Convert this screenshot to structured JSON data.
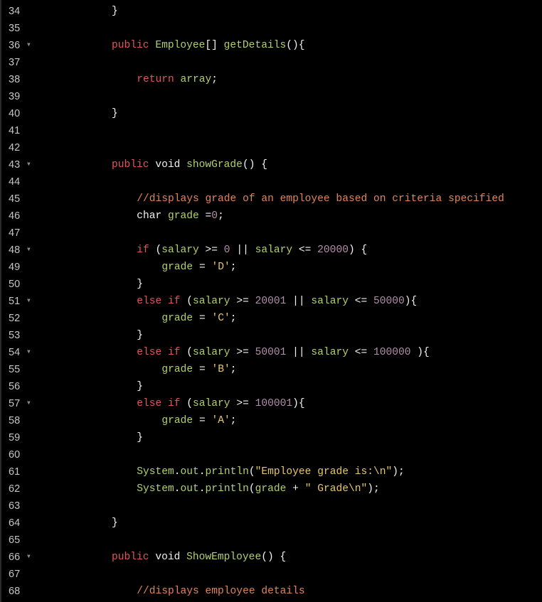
{
  "editor": {
    "theme_colors": {
      "background": "#000000",
      "gutter_text": "#c6c6c6",
      "keyword": "#e0545d",
      "type": "#f2f2f2",
      "identifier": "#b2d16c",
      "number": "#b48ead",
      "string": "#e6c76a",
      "comment": "#e0855a",
      "punctuation": "#f2f2f2"
    },
    "fold_icon": "triangle-down",
    "lines": [
      {
        "num": "34",
        "indent": 0,
        "fold": false,
        "tokens": [
          [
            "punc",
            "}"
          ]
        ]
      },
      {
        "num": "35",
        "indent": 0,
        "fold": false,
        "tokens": []
      },
      {
        "num": "36",
        "indent": 0,
        "fold": true,
        "tokens": [
          [
            "kw",
            "public"
          ],
          [
            "plain",
            " "
          ],
          [
            "ident",
            "Employee"
          ],
          [
            "punc",
            "[]"
          ],
          [
            "plain",
            " "
          ],
          [
            "ident",
            "getDetails"
          ],
          [
            "punc",
            "(){"
          ]
        ]
      },
      {
        "num": "37",
        "indent": 0,
        "fold": false,
        "tokens": []
      },
      {
        "num": "38",
        "indent": 1,
        "fold": false,
        "tokens": [
          [
            "kw",
            "return"
          ],
          [
            "plain",
            " "
          ],
          [
            "ident",
            "array"
          ],
          [
            "punc",
            ";"
          ]
        ]
      },
      {
        "num": "39",
        "indent": 0,
        "fold": false,
        "tokens": []
      },
      {
        "num": "40",
        "indent": 0,
        "fold": false,
        "tokens": [
          [
            "punc",
            "}"
          ]
        ]
      },
      {
        "num": "41",
        "indent": 0,
        "fold": false,
        "tokens": []
      },
      {
        "num": "42",
        "indent": 0,
        "fold": false,
        "tokens": []
      },
      {
        "num": "43",
        "indent": 0,
        "fold": true,
        "tokens": [
          [
            "kw",
            "public"
          ],
          [
            "plain",
            " "
          ],
          [
            "type",
            "void"
          ],
          [
            "plain",
            " "
          ],
          [
            "ident",
            "showGrade"
          ],
          [
            "punc",
            "() {"
          ]
        ]
      },
      {
        "num": "44",
        "indent": 0,
        "fold": false,
        "tokens": []
      },
      {
        "num": "45",
        "indent": 1,
        "fold": false,
        "tokens": [
          [
            "comment",
            "//displays grade of an employee based on criteria specified"
          ]
        ]
      },
      {
        "num": "46",
        "indent": 1,
        "fold": false,
        "tokens": [
          [
            "type",
            "char"
          ],
          [
            "plain",
            " "
          ],
          [
            "ident",
            "grade"
          ],
          [
            "plain",
            " ="
          ],
          [
            "num",
            "0"
          ],
          [
            "punc",
            ";"
          ]
        ]
      },
      {
        "num": "47",
        "indent": 0,
        "fold": false,
        "tokens": []
      },
      {
        "num": "48",
        "indent": 1,
        "fold": true,
        "tokens": [
          [
            "kw",
            "if"
          ],
          [
            "plain",
            " ("
          ],
          [
            "ident",
            "salary"
          ],
          [
            "plain",
            " >= "
          ],
          [
            "num",
            "0"
          ],
          [
            "plain",
            " || "
          ],
          [
            "ident",
            "salary"
          ],
          [
            "plain",
            " <= "
          ],
          [
            "num",
            "20000"
          ],
          [
            "punc",
            ") {"
          ]
        ]
      },
      {
        "num": "49",
        "indent": 2,
        "fold": false,
        "tokens": [
          [
            "ident",
            "grade"
          ],
          [
            "plain",
            " = "
          ],
          [
            "str",
            "'D'"
          ],
          [
            "punc",
            ";"
          ]
        ]
      },
      {
        "num": "50",
        "indent": 1,
        "fold": false,
        "tokens": [
          [
            "punc",
            "}"
          ]
        ]
      },
      {
        "num": "51",
        "indent": 1,
        "fold": true,
        "tokens": [
          [
            "kw",
            "else"
          ],
          [
            "plain",
            " "
          ],
          [
            "kw",
            "if"
          ],
          [
            "plain",
            " ("
          ],
          [
            "ident",
            "salary"
          ],
          [
            "plain",
            " >= "
          ],
          [
            "num",
            "20001"
          ],
          [
            "plain",
            " || "
          ],
          [
            "ident",
            "salary"
          ],
          [
            "plain",
            " <= "
          ],
          [
            "num",
            "50000"
          ],
          [
            "punc",
            "){"
          ]
        ]
      },
      {
        "num": "52",
        "indent": 2,
        "fold": false,
        "tokens": [
          [
            "ident",
            "grade"
          ],
          [
            "plain",
            " = "
          ],
          [
            "str",
            "'C'"
          ],
          [
            "punc",
            ";"
          ]
        ]
      },
      {
        "num": "53",
        "indent": 1,
        "fold": false,
        "tokens": [
          [
            "punc",
            "}"
          ]
        ]
      },
      {
        "num": "54",
        "indent": 1,
        "fold": true,
        "tokens": [
          [
            "kw",
            "else"
          ],
          [
            "plain",
            " "
          ],
          [
            "kw",
            "if"
          ],
          [
            "plain",
            " ("
          ],
          [
            "ident",
            "salary"
          ],
          [
            "plain",
            " >= "
          ],
          [
            "num",
            "50001"
          ],
          [
            "plain",
            " || "
          ],
          [
            "ident",
            "salary"
          ],
          [
            "plain",
            " <= "
          ],
          [
            "num",
            "100000"
          ],
          [
            "punc",
            " ){"
          ]
        ]
      },
      {
        "num": "55",
        "indent": 2,
        "fold": false,
        "tokens": [
          [
            "ident",
            "grade"
          ],
          [
            "plain",
            " = "
          ],
          [
            "str",
            "'B'"
          ],
          [
            "punc",
            ";"
          ]
        ]
      },
      {
        "num": "56",
        "indent": 1,
        "fold": false,
        "tokens": [
          [
            "punc",
            "}"
          ]
        ]
      },
      {
        "num": "57",
        "indent": 1,
        "fold": true,
        "tokens": [
          [
            "kw",
            "else"
          ],
          [
            "plain",
            " "
          ],
          [
            "kw",
            "if"
          ],
          [
            "plain",
            " ("
          ],
          [
            "ident",
            "salary"
          ],
          [
            "plain",
            " >= "
          ],
          [
            "num",
            "100001"
          ],
          [
            "punc",
            "){"
          ]
        ]
      },
      {
        "num": "58",
        "indent": 2,
        "fold": false,
        "tokens": [
          [
            "ident",
            "grade"
          ],
          [
            "plain",
            " = "
          ],
          [
            "str",
            "'A'"
          ],
          [
            "punc",
            ";"
          ]
        ]
      },
      {
        "num": "59",
        "indent": 1,
        "fold": false,
        "tokens": [
          [
            "punc",
            "}"
          ]
        ]
      },
      {
        "num": "60",
        "indent": 0,
        "fold": false,
        "tokens": []
      },
      {
        "num": "61",
        "indent": 1,
        "fold": false,
        "tokens": [
          [
            "ident",
            "System"
          ],
          [
            "punc",
            "."
          ],
          [
            "ident",
            "out"
          ],
          [
            "punc",
            "."
          ],
          [
            "ident",
            "println"
          ],
          [
            "punc",
            "("
          ],
          [
            "str",
            "\"Employee grade is:\\n\""
          ],
          [
            "punc",
            ");"
          ]
        ]
      },
      {
        "num": "62",
        "indent": 1,
        "fold": false,
        "tokens": [
          [
            "ident",
            "System"
          ],
          [
            "punc",
            "."
          ],
          [
            "ident",
            "out"
          ],
          [
            "punc",
            "."
          ],
          [
            "ident",
            "println"
          ],
          [
            "punc",
            "("
          ],
          [
            "ident",
            "grade"
          ],
          [
            "plain",
            " + "
          ],
          [
            "str",
            "\" Grade\\n\""
          ],
          [
            "punc",
            ");"
          ]
        ]
      },
      {
        "num": "63",
        "indent": 0,
        "fold": false,
        "tokens": []
      },
      {
        "num": "64",
        "indent": 0,
        "fold": false,
        "tokens": [
          [
            "punc",
            "}"
          ]
        ]
      },
      {
        "num": "65",
        "indent": 0,
        "fold": false,
        "tokens": []
      },
      {
        "num": "66",
        "indent": 0,
        "fold": true,
        "tokens": [
          [
            "kw",
            "public"
          ],
          [
            "plain",
            " "
          ],
          [
            "type",
            "void"
          ],
          [
            "plain",
            " "
          ],
          [
            "ident",
            "ShowEmployee"
          ],
          [
            "punc",
            "() {"
          ]
        ]
      },
      {
        "num": "67",
        "indent": 0,
        "fold": false,
        "tokens": []
      },
      {
        "num": "68",
        "indent": 1,
        "fold": false,
        "tokens": [
          [
            "comment",
            "//displays employee details"
          ]
        ]
      }
    ]
  }
}
